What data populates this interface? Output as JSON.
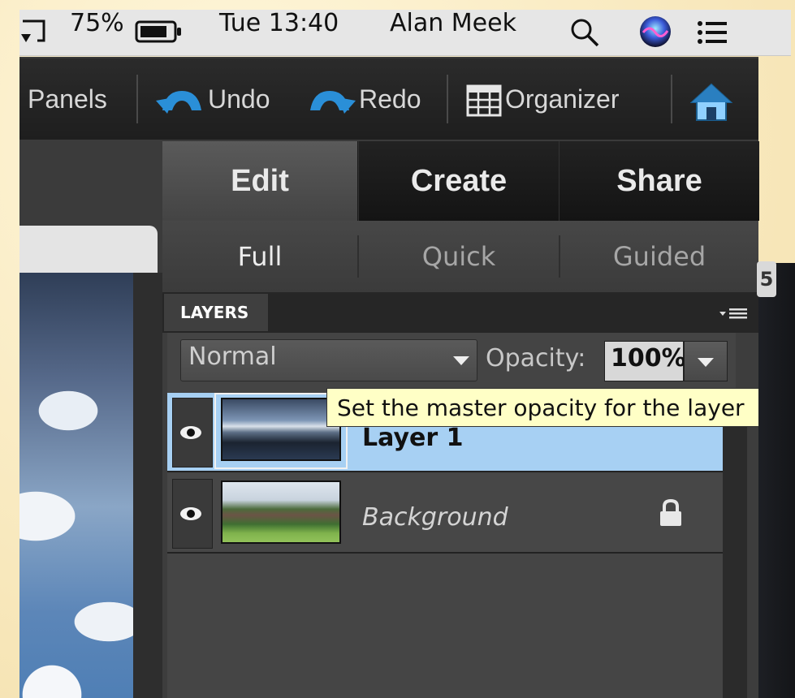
{
  "menubar": {
    "battery_percent": "75%",
    "clock": "Tue 13:40",
    "user_name": "Alan Meek"
  },
  "toolbar": {
    "panels_label": "Panels",
    "undo_label": "Undo",
    "redo_label": "Redo",
    "organizer_label": "Organizer"
  },
  "tabs": {
    "edit": "Edit",
    "create": "Create",
    "share": "Share"
  },
  "subtabs": {
    "full": "Full",
    "quick": "Quick",
    "guided": "Guided"
  },
  "layers_panel": {
    "title": "LAYERS",
    "blend_mode": "Normal",
    "opacity_label": "Opacity:",
    "opacity_value": "100%",
    "tooltip": "Set the master opacity for the layer",
    "layers": [
      {
        "name": "Layer 1",
        "selected": true
      },
      {
        "name": "Background",
        "locked": true
      }
    ]
  },
  "side_badge": "5",
  "colors": {
    "menubar_bg": "#e6e6e6",
    "panel_bg": "#3d3d3d",
    "selected_layer": "#a7d0f3",
    "tooltip_bg": "#ffffc6",
    "frame_bg": "#fbf0cf",
    "icon_blue": "#2a8fd8"
  },
  "icons": [
    "screen-mirror-icon",
    "battery-icon",
    "search-icon",
    "siri-icon",
    "notification-list-icon",
    "undo-icon",
    "redo-icon",
    "organizer-icon",
    "home-icon",
    "eye-icon",
    "lock-icon",
    "panel-menu-icon",
    "chevron-down-icon"
  ]
}
